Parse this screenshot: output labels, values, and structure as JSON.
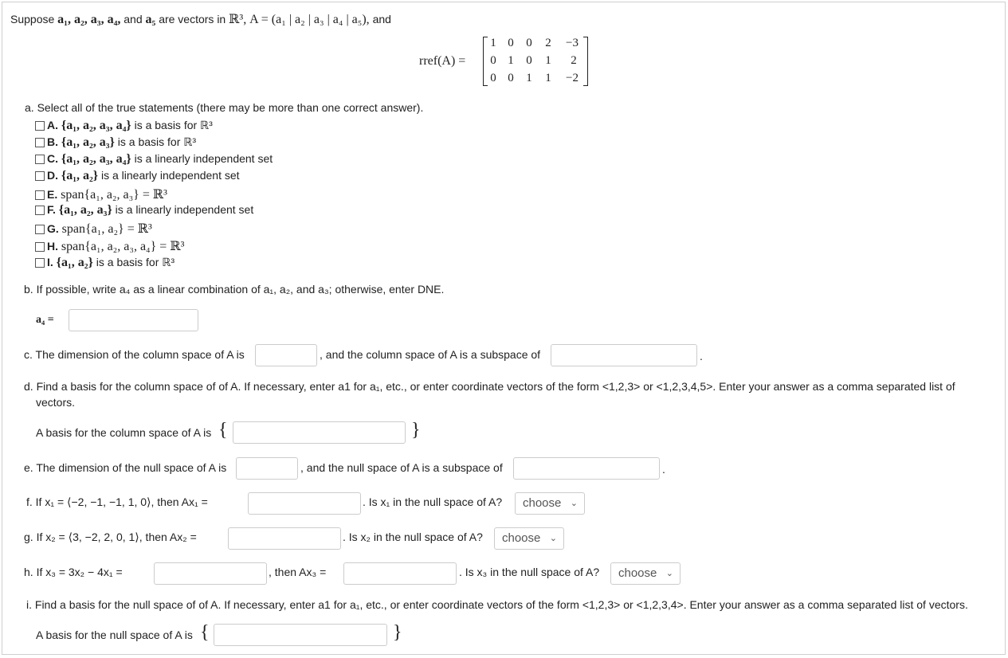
{
  "intro": {
    "suppose": "Suppose",
    "vecs": "a₁, a₂, a₃, a₄,",
    "and": "and",
    "a5": "a₅",
    "are_vectors": "are vectors in",
    "R3": "ℝ³,",
    "A_def": "A = (a₁ | a₂ | a₃ | a₄ | a₅),",
    "and2": "and"
  },
  "rref": {
    "label": "rref(A) =",
    "rows": [
      [
        "1",
        "0",
        "0",
        "2",
        "−3"
      ],
      [
        "0",
        "1",
        "0",
        "1",
        "2"
      ],
      [
        "0",
        "0",
        "1",
        "1",
        "−2"
      ]
    ]
  },
  "part_a": {
    "prompt": "a. Select all of the true statements (there may be more than one correct answer).",
    "options": [
      {
        "letter": "A.",
        "math": "{a₁, a₂, a₃, a₄}",
        "text": "is a basis for ℝ³"
      },
      {
        "letter": "B.",
        "math": "{a₁, a₂, a₃}",
        "text": "is a basis for ℝ³"
      },
      {
        "letter": "C.",
        "math": "{a₁, a₂, a₃, a₄}",
        "text": "is a linearly independent set"
      },
      {
        "letter": "D.",
        "math": "{a₁, a₂}",
        "text": "is a linearly independent set"
      },
      {
        "letter": "E.",
        "math": "span{a₁, a₂, a₃} = ℝ³",
        "text": ""
      },
      {
        "letter": "F.",
        "math": "{a₁, a₂, a₃}",
        "text": "is a linearly independent set"
      },
      {
        "letter": "G.",
        "math": "span{a₁, a₂} = ℝ³",
        "text": ""
      },
      {
        "letter": "H.",
        "math": "span{a₁, a₂, a₃, a₄} = ℝ³",
        "text": ""
      },
      {
        "letter": "I.",
        "math": "{a₁, a₂}",
        "text": "is a basis for ℝ³"
      }
    ]
  },
  "part_b": {
    "prompt": "b. If possible, write a₄ as a linear combination of a₁, a₂, and a₃; otherwise, enter DNE.",
    "label": "a₄ =",
    "value": ""
  },
  "part_c": {
    "prompt1": "c. The dimension of the column space of A is",
    "prompt2": ", and the column space of A is a subspace of",
    "end": "."
  },
  "part_d": {
    "line1": "d. Find a basis for the column space of of A. If necessary, enter a1 for a₁, etc., or enter coordinate vectors of the form <1,2,3> or <1,2,3,4,5>. Enter your answer as a comma separated list of",
    "line2": "vectors.",
    "label": "A basis for the column space of A is",
    "open": "{",
    "close": "}"
  },
  "part_e": {
    "prompt1": "e. The dimension of the null space of A is",
    "prompt2": ", and the null space of A is a subspace of",
    "end": "."
  },
  "part_f": {
    "prompt1": "f. If x₁ = ⟨−2, −1, −1, 1, 0⟩, then Ax₁ =",
    "prompt2": ". Is x₁ in the null space of A?",
    "select": "choose"
  },
  "part_g": {
    "prompt1": "g. If x₂ = ⟨3, −2, 2, 0, 1⟩, then Ax₂ =",
    "prompt2": ". Is x₂ in the null space of A?",
    "select": "choose"
  },
  "part_h": {
    "prompt1": "h. If x₃ = 3x₂ − 4x₁ =",
    "prompt2": ", then Ax₃ =",
    "prompt3": ". Is x₃ in the null space of A?",
    "select": "choose"
  },
  "part_i": {
    "prompt": "i. Find a basis for the null space of of A. If necessary, enter a1 for a₁, etc., or enter coordinate vectors of the form <1,2,3> or <1,2,3,4>. Enter your answer as a comma separated list of vectors.",
    "label": "A basis for the null space of A is",
    "open": "{",
    "close": "}"
  }
}
